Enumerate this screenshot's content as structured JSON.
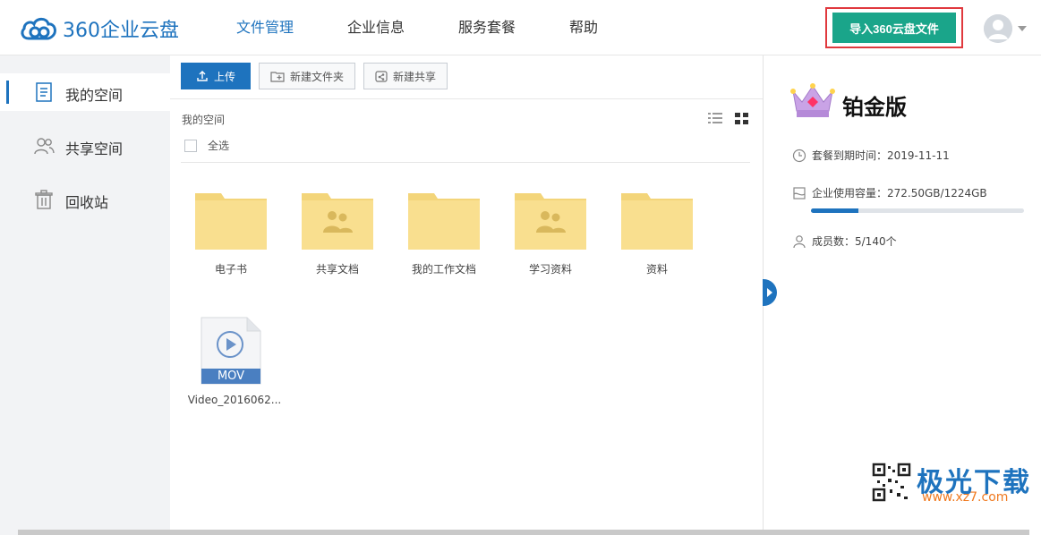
{
  "header": {
    "logo_text": "360企业云盘",
    "nav": [
      "文件管理",
      "企业信息",
      "服务套餐",
      "帮助"
    ],
    "active_nav": "文件管理",
    "import_button": "导入360云盘文件"
  },
  "sidebar": {
    "items": [
      {
        "label": "我的空间",
        "icon": "document-icon",
        "active": true
      },
      {
        "label": "共享空间",
        "icon": "users-icon",
        "active": false
      },
      {
        "label": "回收站",
        "icon": "trash-icon",
        "active": false
      }
    ]
  },
  "toolbar": {
    "upload": "上传",
    "new_folder": "新建文件夹",
    "new_share": "新建共享"
  },
  "main": {
    "breadcrumb": "我的空间",
    "select_all": "全选",
    "files": [
      {
        "name": "电子书",
        "type": "folder"
      },
      {
        "name": "共享文档",
        "type": "shared-folder"
      },
      {
        "name": "我的工作文档",
        "type": "folder"
      },
      {
        "name": "学习资料",
        "type": "shared-folder"
      },
      {
        "name": "资料",
        "type": "folder"
      },
      {
        "name": "Video_2016062...",
        "type": "video",
        "ext": "MOV"
      }
    ]
  },
  "right_panel": {
    "plan": "铂金版",
    "expire": "套餐到期时间：2019-11-11",
    "usage": "企业使用容量：272.50GB/1224GB",
    "usage_fraction": 0.2226,
    "members": "成员数：5/140个"
  },
  "watermark": {
    "brand": "极光下载",
    "url": "www.xz7.com"
  },
  "colors": {
    "accent": "#1e73be",
    "import_green": "#1aa58a",
    "highlight_red": "#e0393e",
    "folder": "#f9df8f"
  }
}
